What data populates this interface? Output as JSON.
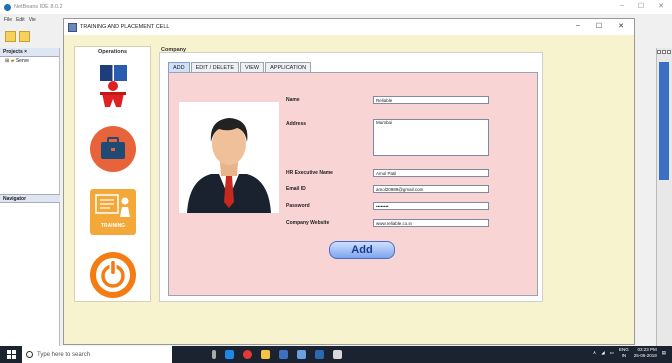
{
  "netbeans": {
    "title": "NetBeans IDE 8.0.2",
    "menu": [
      "File",
      "Edit",
      "Vie"
    ],
    "projects_header": "Projects ×",
    "projects_node": "Serve",
    "navigator_label": "Navigator"
  },
  "app": {
    "title": "TRAINING AND PLACEMENT CELL",
    "controls": {
      "minimize": "–",
      "maximize": "☐",
      "close": "✕"
    }
  },
  "operations": {
    "label": "Operations",
    "buttons": [
      {
        "icon": "student-books-icon"
      },
      {
        "icon": "company-briefcase-icon"
      },
      {
        "icon": "training-icon",
        "label": "TRAINING"
      },
      {
        "icon": "power-icon"
      }
    ]
  },
  "company": {
    "label": "Company",
    "tabs": [
      "ADD",
      "EDIT / DELETE",
      "VIEW",
      "APPLICATION"
    ],
    "active_tab": "ADD",
    "form": {
      "name_label": "Name",
      "name_value": "Reliable",
      "address_label": "Address",
      "address_value": "Mumbai",
      "hr_label": "HR Executive Name",
      "hr_value": "Amol Patil",
      "email_label": "Email ID",
      "email_value": "amol20989@gmail.com",
      "password_label": "Password",
      "password_value": "••••••••",
      "website_label": "Company Website",
      "website_value": "www.reliable.co.in",
      "add_button": "Add"
    }
  },
  "taskbar": {
    "search_placeholder": "Type here to search",
    "lang": "ENG",
    "region": "IN",
    "time": "03:23 PM",
    "date": "25-06-2019"
  },
  "colors": {
    "app_bg": "#f7f3cf",
    "form_bg": "#f9d4d4",
    "add_button": "#7ea4ee",
    "taskbar": "#1c2330"
  }
}
